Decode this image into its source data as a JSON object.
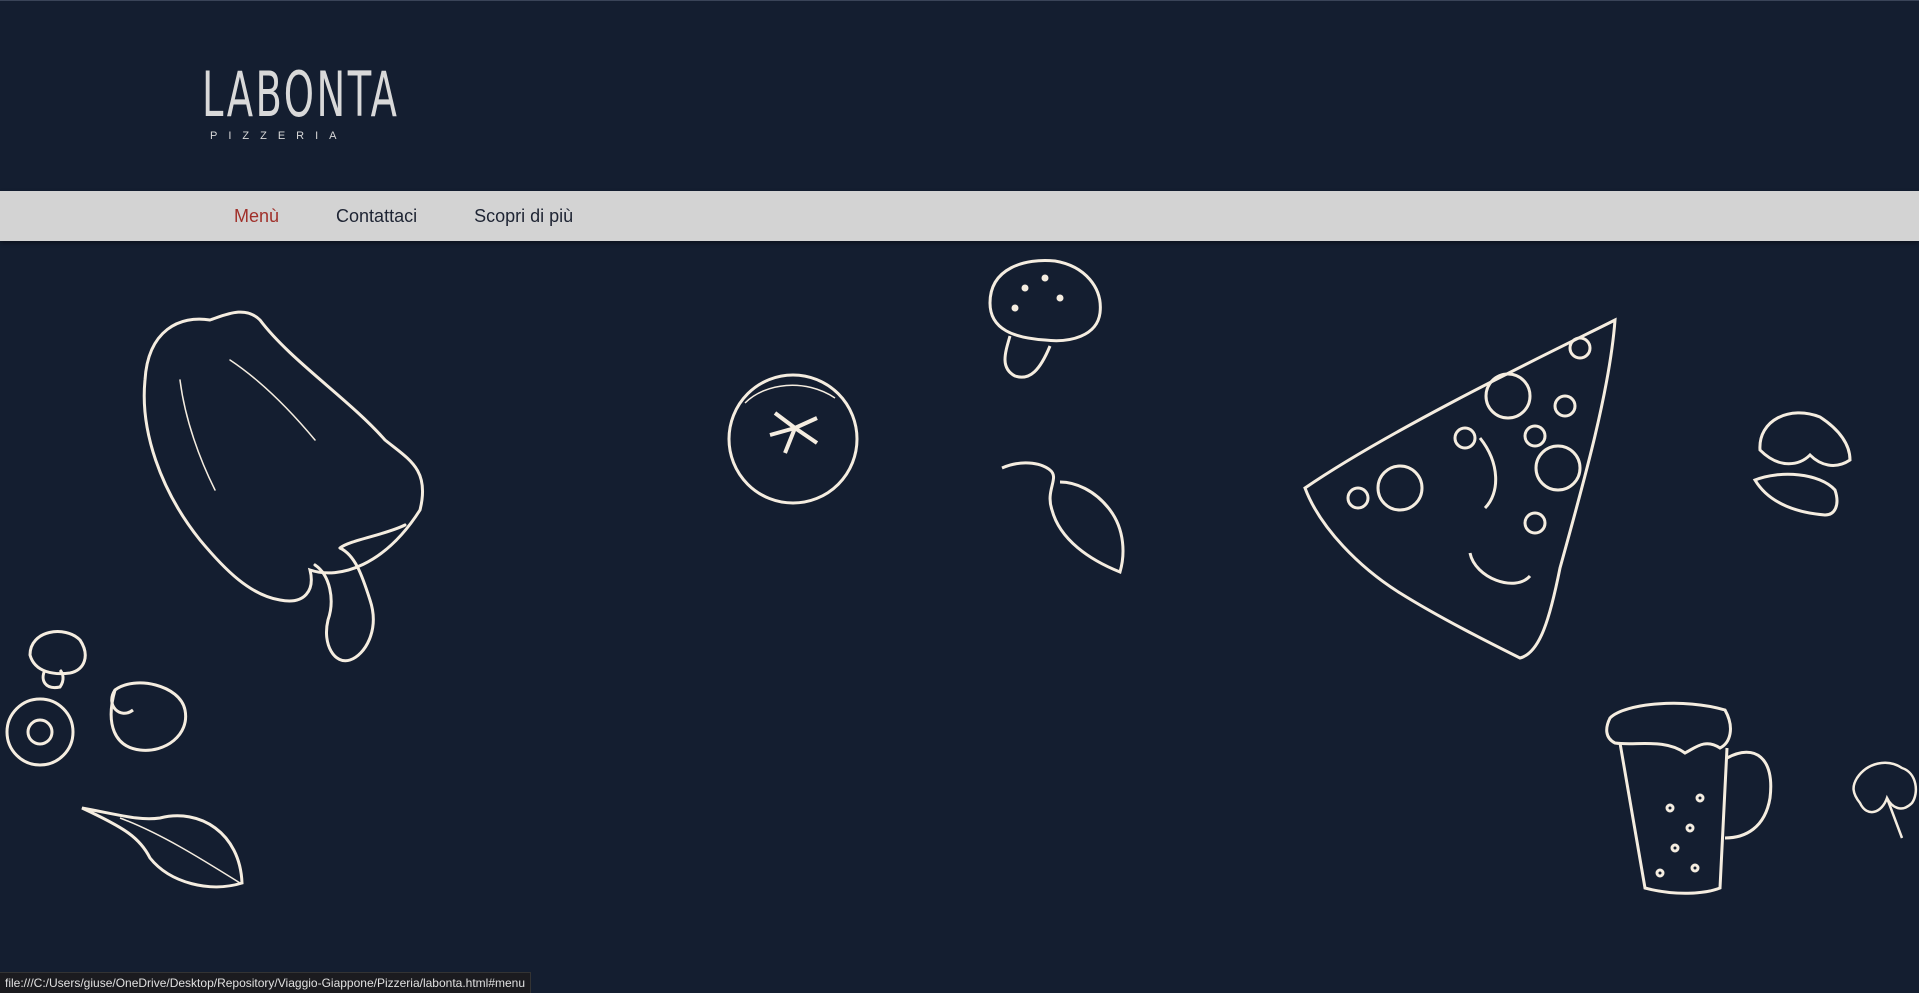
{
  "logo": {
    "title": "LABONTA",
    "subtitle": "PIZZERIA"
  },
  "nav": {
    "items": [
      {
        "label": "Menù",
        "active": true
      },
      {
        "label": "Contattaci",
        "active": false
      },
      {
        "label": "Scopri di più",
        "active": false
      }
    ]
  },
  "colors": {
    "background": "#141e30",
    "nav_bar": "#d3d3d3",
    "nav_active": "#a0302a",
    "nav_text": "#1e2433",
    "illustration_stroke": "#f5ede0"
  },
  "illustrations": [
    "bell-pepper-icon",
    "mushroom-icon",
    "tomato-icon",
    "chili-pepper-icon",
    "pizza-slice-icon",
    "garlic-icon",
    "beer-mug-icon",
    "parsley-icon",
    "basil-leaf-icon",
    "mushrooms-icon"
  ],
  "status_bar": {
    "url": "file:///C:/Users/giuse/OneDrive/Desktop/Repository/Viaggio-Giappone/Pizzeria/labonta.html#menu"
  }
}
